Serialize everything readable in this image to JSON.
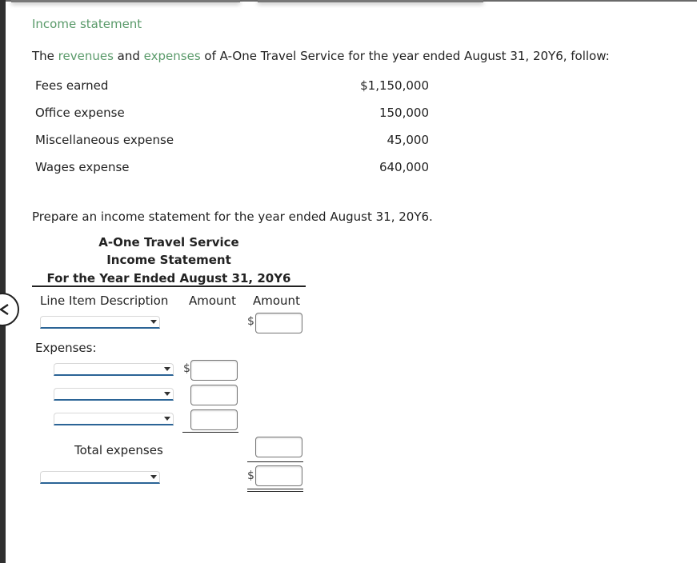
{
  "section_title": "Income statement",
  "intro": {
    "prefix": "The ",
    "link_revenues": "revenues",
    "middle": " and ",
    "link_expenses": "expenses",
    "suffix": " of A-One Travel Service for the year ended August 31, 20Y6, follow:"
  },
  "given_data": [
    {
      "label": "Fees earned",
      "value": "$1,150,000"
    },
    {
      "label": "Office expense",
      "value": "150,000"
    },
    {
      "label": "Miscellaneous expense",
      "value": "45,000"
    },
    {
      "label": "Wages expense",
      "value": "640,000"
    }
  ],
  "instruction": "Prepare an income statement for the year ended August 31, 20Y6.",
  "statement": {
    "company": "A-One Travel Service",
    "title": "Income Statement",
    "period": "For the Year Ended August 31, 20Y6",
    "col_description": "Line Item Description",
    "col_amount1": "Amount",
    "col_amount2": "Amount",
    "expenses_label": "Expenses:",
    "total_expenses_label": "Total expenses",
    "currency_symbol": "$",
    "revenue_select": "",
    "revenue_amount": "",
    "expense_rows": [
      {
        "select": "",
        "amount": ""
      },
      {
        "select": "",
        "amount": ""
      },
      {
        "select": "",
        "amount": ""
      }
    ],
    "total_expenses_amount": "",
    "net_select": "",
    "net_amount": ""
  },
  "colors": {
    "link_green": "#5a9a6a",
    "select_underline": "#2b6496"
  }
}
